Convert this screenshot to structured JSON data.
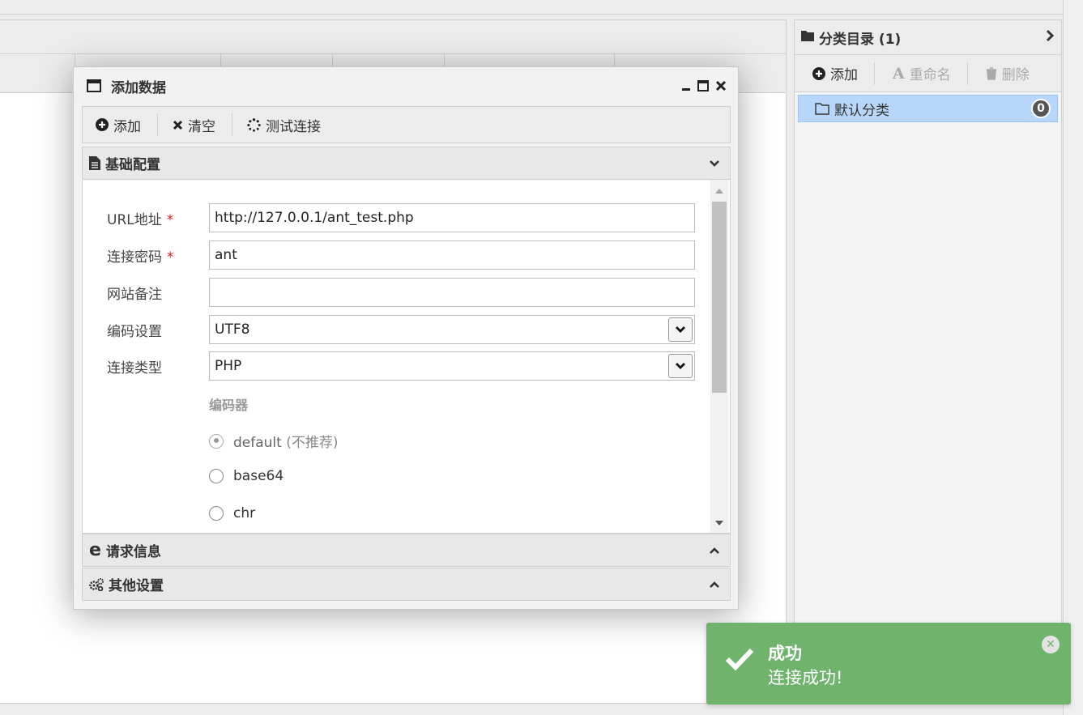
{
  "dialog": {
    "title": "添加数据",
    "toolbar": {
      "add": "添加",
      "clear": "清空",
      "test": "测试连接"
    },
    "sections": {
      "basic": "基础配置",
      "request": "请求信息",
      "other": "其他设置"
    },
    "form": {
      "url_label": "URL地址",
      "url_value": "http://127.0.0.1/ant_test.php",
      "password_label": "连接密码",
      "password_value": "ant",
      "note_label": "网站备注",
      "note_value": "",
      "encoding_label": "编码设置",
      "encoding_value": "UTF8",
      "type_label": "连接类型",
      "type_value": "PHP",
      "required_mark": "*",
      "encoder_title": "编码器",
      "encoders": [
        {
          "label": "default",
          "note": "(不推荐)",
          "selected": true
        },
        {
          "label": "base64",
          "note": "",
          "selected": false
        },
        {
          "label": "chr",
          "note": "",
          "selected": false
        }
      ]
    }
  },
  "category": {
    "title": "分类目录 (1)",
    "toolbar": {
      "add": "添加",
      "rename": "重命名",
      "delete": "删除"
    },
    "items": [
      {
        "label": "默认分类",
        "count": "0"
      }
    ]
  },
  "toast": {
    "title": "成功",
    "message": "连接成功!"
  },
  "colors": {
    "toast_bg": "#6fb36d",
    "selected_item": "#b7d6fa",
    "required": "#d22"
  }
}
